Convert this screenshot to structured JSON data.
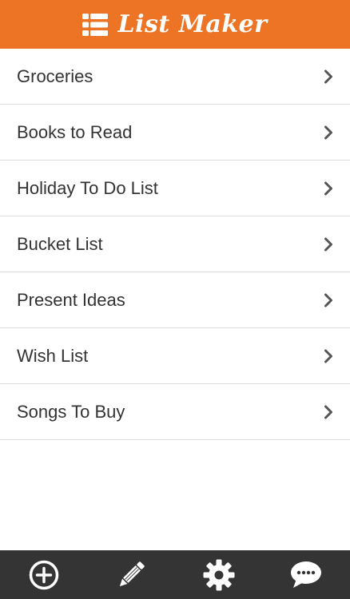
{
  "header": {
    "title": "List Maker",
    "logo_icon": "list-icon",
    "background_color": "#ec7424"
  },
  "lists": {
    "items": [
      {
        "label": "Groceries"
      },
      {
        "label": "Books to Read"
      },
      {
        "label": "Holiday To Do List"
      },
      {
        "label": "Bucket List"
      },
      {
        "label": "Present Ideas"
      },
      {
        "label": "Wish List"
      },
      {
        "label": "Songs To Buy"
      }
    ],
    "row_icon": "chevron-right-icon"
  },
  "toolbar": {
    "background_color": "#343434",
    "buttons": [
      {
        "icon": "add-circle-icon"
      },
      {
        "icon": "pencil-icon"
      },
      {
        "icon": "gear-icon"
      },
      {
        "icon": "chat-bubble-icon"
      }
    ]
  }
}
